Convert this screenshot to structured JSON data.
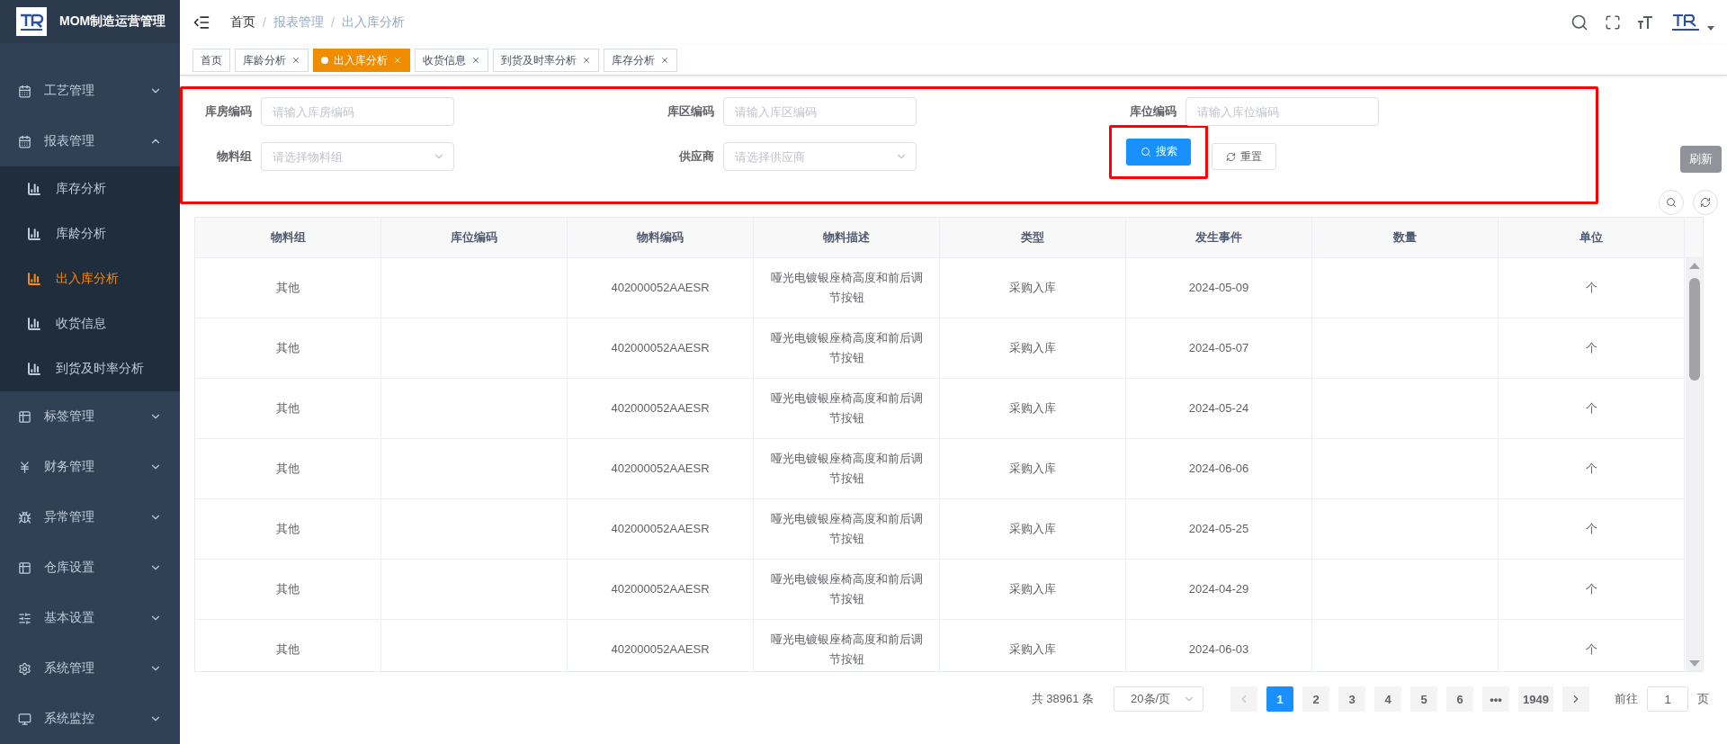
{
  "app": {
    "title": "MOM制造运营管理"
  },
  "sidebar": {
    "items": [
      {
        "label": "工艺管理",
        "expanded": false
      },
      {
        "label": "报表管理",
        "expanded": true,
        "children": [
          {
            "label": "库存分析",
            "selected": false
          },
          {
            "label": "库龄分析",
            "selected": false
          },
          {
            "label": "出入库分析",
            "selected": true
          },
          {
            "label": "收货信息",
            "selected": false
          },
          {
            "label": "到货及时率分析",
            "selected": false
          }
        ]
      },
      {
        "label": "标签管理",
        "expanded": false
      },
      {
        "label": "财务管理",
        "expanded": false
      },
      {
        "label": "异常管理",
        "expanded": false
      },
      {
        "label": "仓库设置",
        "expanded": false
      },
      {
        "label": "基本设置",
        "expanded": false
      },
      {
        "label": "系统管理",
        "expanded": false
      },
      {
        "label": "系统监控",
        "expanded": false
      }
    ]
  },
  "breadcrumb": {
    "separator": "/",
    "items": [
      "首页",
      "报表管理",
      "出入库分析"
    ]
  },
  "tabs": [
    {
      "label": "首页",
      "selected": false,
      "closable": false
    },
    {
      "label": "库龄分析",
      "selected": false,
      "closable": true
    },
    {
      "label": "出入库分析",
      "selected": true,
      "closable": true
    },
    {
      "label": "收货信息",
      "selected": false,
      "closable": true
    },
    {
      "label": "到货及时率分析",
      "selected": false,
      "closable": true
    },
    {
      "label": "库存分析",
      "selected": false,
      "closable": true
    }
  ],
  "filters": [
    {
      "label": "库房编码",
      "placeholder": "请输入库房编码",
      "kind": "input"
    },
    {
      "label": "库区编码",
      "placeholder": "请输入库区编码",
      "kind": "input"
    },
    {
      "label": "库位编码",
      "placeholder": "请输入库位编码",
      "kind": "input"
    },
    {
      "label": "物料组",
      "placeholder": "请选择物料组",
      "kind": "select"
    },
    {
      "label": "供应商",
      "placeholder": "请选择供应商",
      "kind": "select"
    }
  ],
  "buttons": {
    "search": "搜索",
    "reset": "重置"
  },
  "tooltip": "刷新",
  "table": {
    "columns": [
      "物料组",
      "库位编码",
      "物料编码",
      "物料描述",
      "类型",
      "发生事件",
      "数量",
      "单位"
    ],
    "rows": [
      [
        "其他",
        "",
        "402000052AAESR",
        "哑光电镀银座椅高度和前后调节按钮",
        "采购入库",
        "2024-05-09",
        "",
        "个"
      ],
      [
        "其他",
        "",
        "402000052AAESR",
        "哑光电镀银座椅高度和前后调节按钮",
        "采购入库",
        "2024-05-07",
        "",
        "个"
      ],
      [
        "其他",
        "",
        "402000052AAESR",
        "哑光电镀银座椅高度和前后调节按钮",
        "采购入库",
        "2024-05-24",
        "",
        "个"
      ],
      [
        "其他",
        "",
        "402000052AAESR",
        "哑光电镀银座椅高度和前后调节按钮",
        "采购入库",
        "2024-06-06",
        "",
        "个"
      ],
      [
        "其他",
        "",
        "402000052AAESR",
        "哑光电镀银座椅高度和前后调节按钮",
        "采购入库",
        "2024-05-25",
        "",
        "个"
      ],
      [
        "其他",
        "",
        "402000052AAESR",
        "哑光电镀银座椅高度和前后调节按钮",
        "采购入库",
        "2024-04-29",
        "",
        "个"
      ],
      [
        "其他",
        "",
        "402000052AAESR",
        "哑光电镀银座椅高度和前后调节按钮",
        "采购入库",
        "2024-06-03",
        "",
        "个"
      ]
    ]
  },
  "pagination": {
    "total": "共 38961 条",
    "page_size": "20条/页",
    "pages": [
      {
        "label": "1",
        "selected": true
      },
      {
        "label": "2",
        "selected": false
      },
      {
        "label": "3",
        "selected": false
      },
      {
        "label": "4",
        "selected": false
      },
      {
        "label": "5",
        "selected": false
      },
      {
        "label": "6",
        "selected": false
      },
      {
        "label": "•••",
        "selected": false
      },
      {
        "label": "1949",
        "selected": false
      }
    ],
    "goto_label": "前往",
    "goto_value": "1",
    "goto_suffix": "页"
  }
}
